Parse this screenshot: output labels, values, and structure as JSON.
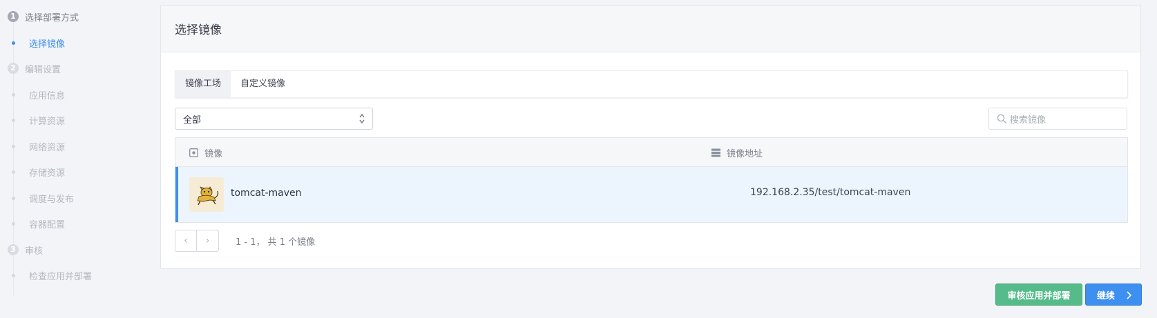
{
  "stepper": {
    "steps": [
      {
        "num": "1",
        "label": "选择部署方式",
        "subs": [
          {
            "label": "选择镜像"
          }
        ]
      },
      {
        "num": "2",
        "label": "编辑设置",
        "subs": [
          {
            "label": "应用信息"
          },
          {
            "label": "计算资源"
          },
          {
            "label": "网络资源"
          },
          {
            "label": "存储资源"
          },
          {
            "label": "调度与发布"
          },
          {
            "label": "容器配置"
          }
        ]
      },
      {
        "num": "3",
        "label": "审核",
        "subs": [
          {
            "label": "检查应用并部署"
          }
        ]
      }
    ]
  },
  "card": {
    "title": "选择镜像",
    "tabs": [
      "镜像工场",
      "自定义镜像"
    ],
    "filter": {
      "value": "全部"
    },
    "search": {
      "placeholder": "搜索镜像"
    },
    "table": {
      "columns": [
        {
          "label": "镜像",
          "icon": "image-icon"
        },
        {
          "label": "镜像地址",
          "icon": "server-icon"
        }
      ],
      "rows": [
        {
          "name": "tomcat-maven",
          "address": "192.168.2.35/test/tomcat-maven",
          "icon": "tomcat-logo"
        }
      ]
    },
    "pager": {
      "prev": "‹",
      "next": "›",
      "info": "1 - 1， 共 1 个镜像"
    }
  },
  "actions": {
    "review_label": "审核应用并部署",
    "continue_label": "继续"
  },
  "colors": {
    "accent": "#3d8ff0",
    "success": "#55bb8a",
    "selected_row": "#ecf5fe"
  }
}
